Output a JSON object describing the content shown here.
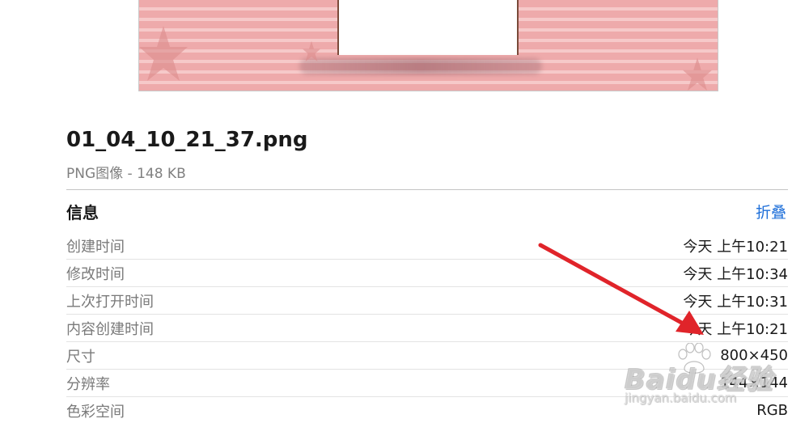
{
  "file": {
    "name": "01_04_10_21_37.png",
    "kind_size": "PNG图像 - 148 KB"
  },
  "info_section": {
    "title": "信息",
    "collapse_label": "折叠",
    "rows": [
      {
        "label": "创建时间",
        "value": "今天 上午10:21"
      },
      {
        "label": "修改时间",
        "value": "今天 上午10:34"
      },
      {
        "label": "上次打开时间",
        "value": "今天 上午10:31"
      },
      {
        "label": "内容创建时间",
        "value": "今天 上午10:21"
      },
      {
        "label": "尺寸",
        "value": "800×450"
      },
      {
        "label": "分辨率",
        "value": "144×144"
      },
      {
        "label": "色彩空间",
        "value": "RGB"
      }
    ]
  },
  "watermark": {
    "brand": "Baidu经验",
    "url": "jingyan.baidu.com"
  },
  "colors": {
    "accent_link": "#1e6fd9",
    "annotation_arrow": "#e0242a",
    "preview_pink": "#eeaaab"
  }
}
